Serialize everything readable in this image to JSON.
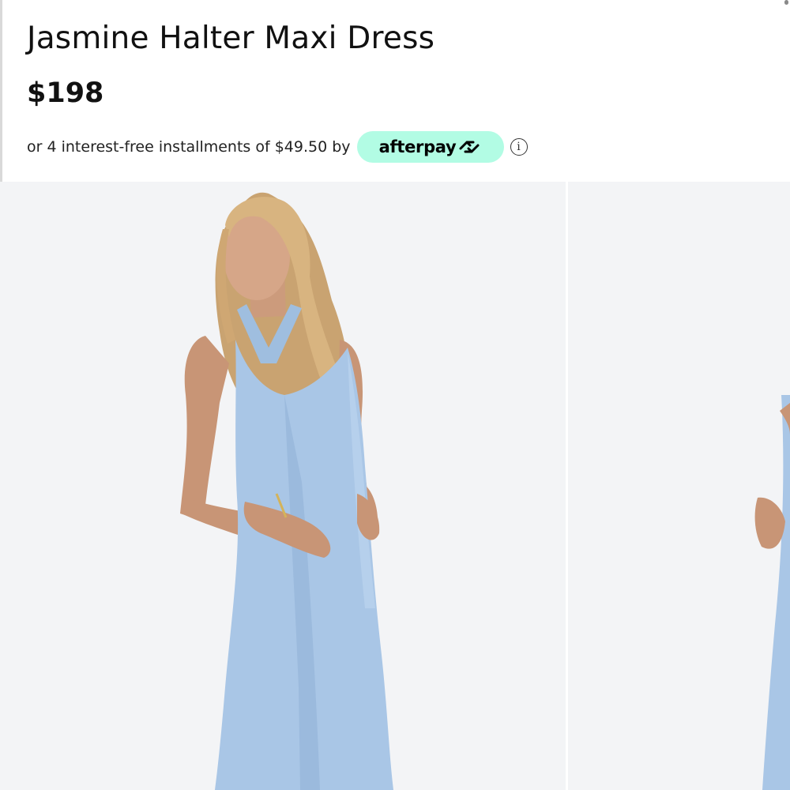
{
  "product": {
    "title": "Jasmine Halter Maxi Dress",
    "price": "$198"
  },
  "installments": {
    "text": "or 4 interest-free installments of $49.50 by",
    "provider": "afterpay",
    "provider_icon": "afterpay-arrows-icon",
    "info_icon": "info-icon",
    "badge_color": "#b2fce4"
  },
  "gallery": {
    "images": [
      {
        "alt": "Model wearing light blue satin halter maxi dress, front view"
      },
      {
        "alt": "Model wearing light blue satin halter maxi dress, next image partially visible"
      }
    ],
    "dress_color": "#a9c6e6",
    "background_color": "#f3f4f6"
  }
}
